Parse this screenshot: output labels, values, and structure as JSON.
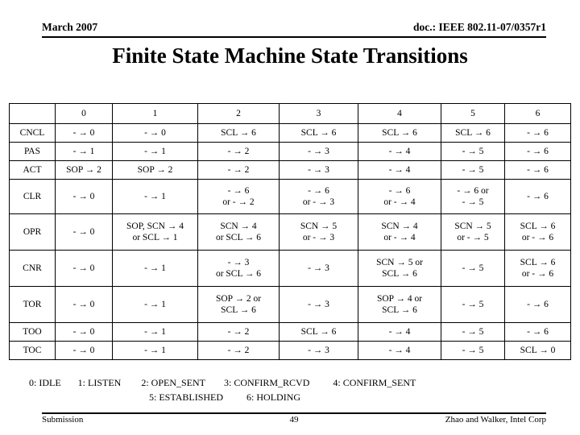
{
  "header": {
    "date": "March 2007",
    "doc_ref": "doc.: IEEE 802.11-07/0357r1"
  },
  "title": "Finite State Machine State Transitions",
  "table": {
    "corner_label": "",
    "column_headers": [
      "0",
      "1",
      "2",
      "3",
      "4",
      "5",
      "6"
    ],
    "rows": [
      {
        "state": "CNCL",
        "cells": [
          "- → 0",
          "- → 0",
          "SCL → 6",
          "SCL → 6",
          "SCL → 6",
          "SCL → 6",
          "- → 6"
        ]
      },
      {
        "state": "PAS",
        "cells": [
          "- → 1",
          "- → 1",
          "- → 2",
          "- → 3",
          "- → 4",
          "- → 5",
          "- → 6"
        ]
      },
      {
        "state": "ACT",
        "cells": [
          "SOP → 2",
          "SOP → 2",
          "- → 2",
          "- → 3",
          "- → 4",
          "- → 5",
          "- → 6"
        ]
      },
      {
        "state": "CLR",
        "cells": [
          "- → 0",
          "- → 1",
          "- → 6\nor - → 2",
          "- → 6\nor - → 3",
          "- → 6\nor - → 4",
          "- → 6 or\n- → 5",
          "- → 6"
        ]
      },
      {
        "state": "OPR",
        "cells": [
          "- → 0",
          "SOP, SCN → 4\nor SCL → 1",
          "SCN → 4\nor SCL → 6",
          "SCN → 5\nor - → 3",
          "SCN → 4\nor - → 4",
          "SCN → 5\nor - → 5",
          "SCL → 6\nor - → 6"
        ]
      },
      {
        "state": "CNR",
        "cells": [
          "- → 0",
          "- → 1",
          "- → 3\nor SCL → 6",
          "- → 3",
          "SCN → 5 or\nSCL → 6",
          "- → 5",
          "SCL → 6\nor - → 6"
        ]
      },
      {
        "state": "TOR",
        "cells": [
          "- → 0",
          "- → 1",
          "SOP → 2 or\nSCL → 6",
          "- → 3",
          "SOP → 4 or\nSCL → 6",
          "- → 5",
          "- → 6"
        ]
      },
      {
        "state": "TOO",
        "cells": [
          "- → 0",
          "- → 1",
          "- → 2",
          "SCL → 6",
          "- → 4",
          "- → 5",
          "- → 6"
        ]
      },
      {
        "state": "TOC",
        "cells": [
          "- → 0",
          "- → 1",
          "- → 2",
          "- → 3",
          "- → 4",
          "- → 5",
          "SCL → 0"
        ]
      }
    ]
  },
  "legend": {
    "line1": [
      "0: IDLE",
      "1: LISTEN",
      "2: OPEN_SENT",
      "3: CONFIRM_RCVD",
      "4: CONFIRM_SENT"
    ],
    "line2": [
      "5: ESTABLISHED",
      "6: HOLDING"
    ]
  },
  "footer": {
    "left": "Submission",
    "page": "49",
    "right": "Zhao and Walker, Intel Corp"
  }
}
